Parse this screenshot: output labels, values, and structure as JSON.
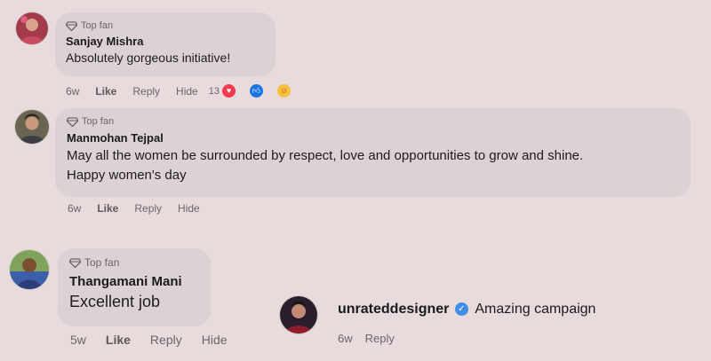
{
  "comments": [
    {
      "badge": "Top fan",
      "author": "Sanjay Mishra",
      "text": "Absolutely gorgeous initiative!",
      "time": "6w",
      "like": "Like",
      "reply": "Reply",
      "hide": "Hide",
      "reaction_count": "13"
    },
    {
      "badge": "Top fan",
      "author": "Manmohan Tejpal",
      "text_line1": "May all the women be surrounded by respect, love and opportunities to grow and shine.",
      "text_line2": "Happy women's day",
      "time": "6w",
      "like": "Like",
      "reply": "Reply",
      "hide": "Hide"
    },
    {
      "badge": "Top fan",
      "author": "Thangamani Mani",
      "text": "Excellent job",
      "time": "5w",
      "like": "Like",
      "reply": "Reply",
      "hide": "Hide"
    }
  ],
  "reply": {
    "author": "unrateddesigner",
    "text": "Amazing campaign",
    "time": "6w",
    "reply": "Reply"
  },
  "colors": {
    "background": "#e7dbdb",
    "bubble": "#dcd2d4",
    "verified": "#3f8fe8",
    "heart_reaction": "#f23b4c",
    "like_reaction": "#1b74e4"
  }
}
